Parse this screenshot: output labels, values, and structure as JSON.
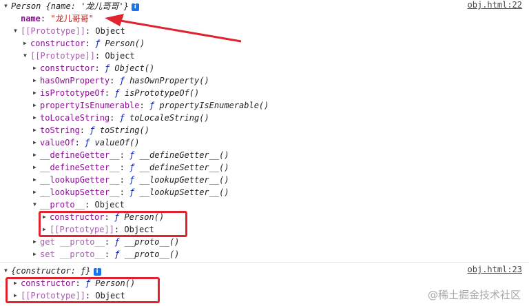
{
  "log1": {
    "summary_prefix": "Person ",
    "summary_obj": "{name: '龙儿哥哥'}",
    "source_link": "obj.html:22",
    "name_key": "name",
    "name_value": "\"龙儿哥哥\"",
    "proto_key": "[[Prototype]]",
    "proto_value": "Object",
    "constructor_key": "constructor",
    "constructor_value": "Person()",
    "inner_proto_key": "[[Prototype]]",
    "inner_proto_value": "Object",
    "members": [
      {
        "key": "constructor",
        "value": "Object()"
      },
      {
        "key": "hasOwnProperty",
        "value": "hasOwnProperty()"
      },
      {
        "key": "isPrototypeOf",
        "value": "isPrototypeOf()"
      },
      {
        "key": "propertyIsEnumerable",
        "value": "propertyIsEnumerable()"
      },
      {
        "key": "toLocaleString",
        "value": "toLocaleString()"
      },
      {
        "key": "toString",
        "value": "toString()"
      },
      {
        "key": "valueOf",
        "value": "valueOf()"
      },
      {
        "key": "__defineGetter__",
        "value": "__defineGetter__()"
      },
      {
        "key": "__defineSetter__",
        "value": "__defineSetter__()"
      },
      {
        "key": "__lookupGetter__",
        "value": "__lookupGetter__()"
      },
      {
        "key": "__lookupSetter__",
        "value": "__lookupSetter__()"
      }
    ],
    "proto_accessor_key": "__proto__",
    "proto_accessor_value": "Object",
    "proto_accessor_constructor_key": "constructor",
    "proto_accessor_constructor_value": "Person()",
    "proto_accessor_proto_key": "[[Prototype]]",
    "proto_accessor_proto_value": "Object",
    "getter_label": "get __proto__",
    "getter_value": "__proto__()",
    "setter_label": "set __proto__",
    "setter_value": "__proto__()"
  },
  "log2": {
    "summary": "{constructor: ƒ}",
    "source_link": "obj.html:23",
    "constructor_key": "constructor",
    "constructor_value": "Person()",
    "proto_key": "[[Prototype]]",
    "proto_value": "Object"
  },
  "function_symbol": "ƒ",
  "watermark": "@稀土掘金技术社区",
  "colors": {
    "annotation_red": "#e0232e",
    "property_key": "#881391",
    "string_value": "#c41a16",
    "info_badge": "#1a73e8"
  },
  "icons": {
    "expanded": "triangle-down-icon",
    "collapsed": "triangle-right-icon",
    "info": "info-icon"
  }
}
